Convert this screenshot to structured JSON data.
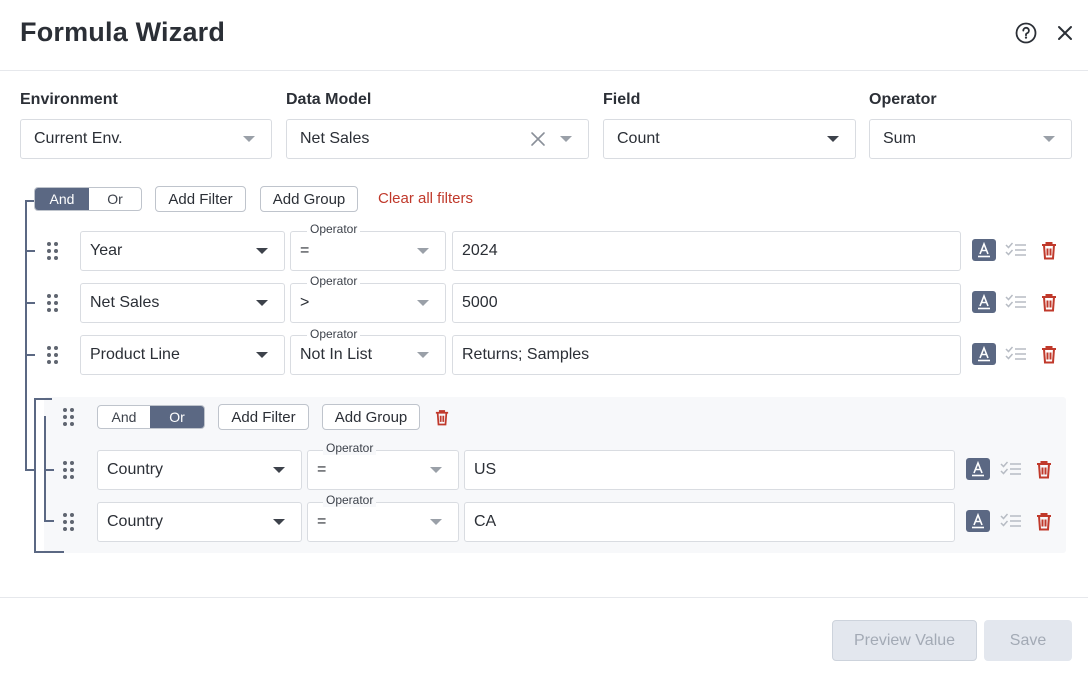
{
  "header": {
    "title": "Formula Wizard",
    "help_icon": "help-circle-icon",
    "close_icon": "close-icon"
  },
  "fields": {
    "environment": {
      "label": "Environment",
      "value": "Current Env."
    },
    "data_model": {
      "label": "Data Model",
      "value": "Net Sales"
    },
    "field": {
      "label": "Field",
      "value": "Count"
    },
    "operator": {
      "label": "Operator",
      "value": "Sum"
    }
  },
  "root_group": {
    "and_label": "And",
    "or_label": "Or",
    "active": "And",
    "add_filter": "Add Filter",
    "add_group": "Add Group",
    "clear_all": "Clear all filters",
    "filters": [
      {
        "field": "Year",
        "operator_label": "Operator",
        "operator": "=",
        "value": "2024"
      },
      {
        "field": "Net Sales",
        "operator_label": "Operator",
        "operator": ">",
        "value": "5000"
      },
      {
        "field": "Product Line",
        "operator_label": "Operator",
        "operator": "Not In List",
        "value": "Returns; Samples"
      }
    ]
  },
  "sub_group": {
    "and_label": "And",
    "or_label": "Or",
    "active": "Or",
    "add_filter": "Add Filter",
    "add_group": "Add Group",
    "filters": [
      {
        "field": "Country",
        "operator_label": "Operator",
        "operator": "=",
        "value": "US"
      },
      {
        "field": "Country",
        "operator_label": "Operator",
        "operator": "=",
        "value": "CA"
      }
    ]
  },
  "footer": {
    "preview": "Preview Value",
    "save": "Save"
  },
  "colors": {
    "accent": "#5b6883",
    "danger": "#c0392b",
    "border": "#d9dce1",
    "disabled_bg": "#e3e7ee"
  }
}
